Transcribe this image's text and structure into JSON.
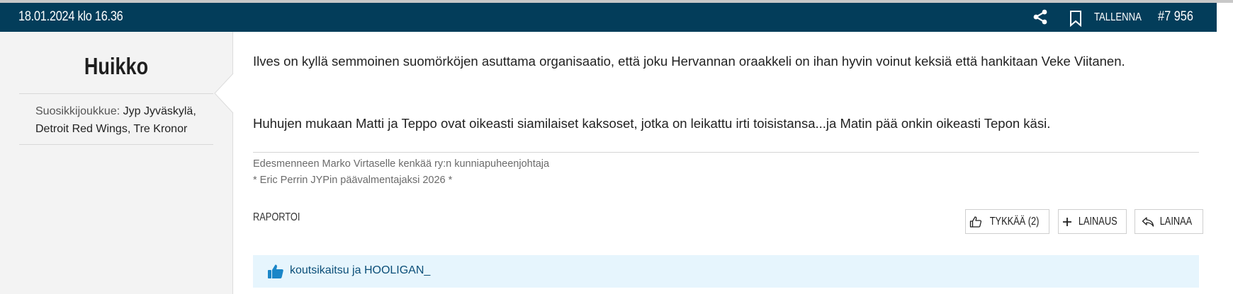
{
  "header": {
    "date": "18.01.2024 klo 16.36",
    "share_icon": "share-icon",
    "bookmark_icon": "bookmark-icon",
    "save_label": "TALLENNA",
    "post_number": "#7 956",
    "bg_color": "#033d5a"
  },
  "author": {
    "username": "Huikko",
    "favorites_label": "Suosikkijoukkue:",
    "favorites_value": "Jyp Jyväskylä, Detroit Red Wings, Tre Kronor"
  },
  "post": {
    "paragraphs": [
      "Ilves on kyllä semmoinen suomörköjen asuttama organisaatio, että joku Hervannan oraakkeli on ihan hyvin voinut keksiä että hankitaan Veke Viitanen.",
      "Huhujen mukaan Matti ja Teppo ovat oikeasti siamilaiset kaksoset, jotka on leikattu irti toisistansa...ja Matin pää onkin oikeasti Tepon käsi."
    ],
    "signature": [
      "Edesmenneen Marko Virtaselle kenkää ry:n kunniapuheenjohtaja",
      "* Eric Perrin JYPin päävalmentajaksi 2026 *"
    ]
  },
  "actions": {
    "report_label": "RAPORTOI",
    "like_label": "TYKKÄÄ (2)",
    "add_quote_label": "LAINAUS",
    "quote_label": "LAINAA"
  },
  "likes": {
    "icon": "thumbs-up-icon",
    "likers": "koutsikaitsu ja HOOLIGAN_",
    "bg_color": "#e6f5fd",
    "link_color": "#0a4e78"
  }
}
